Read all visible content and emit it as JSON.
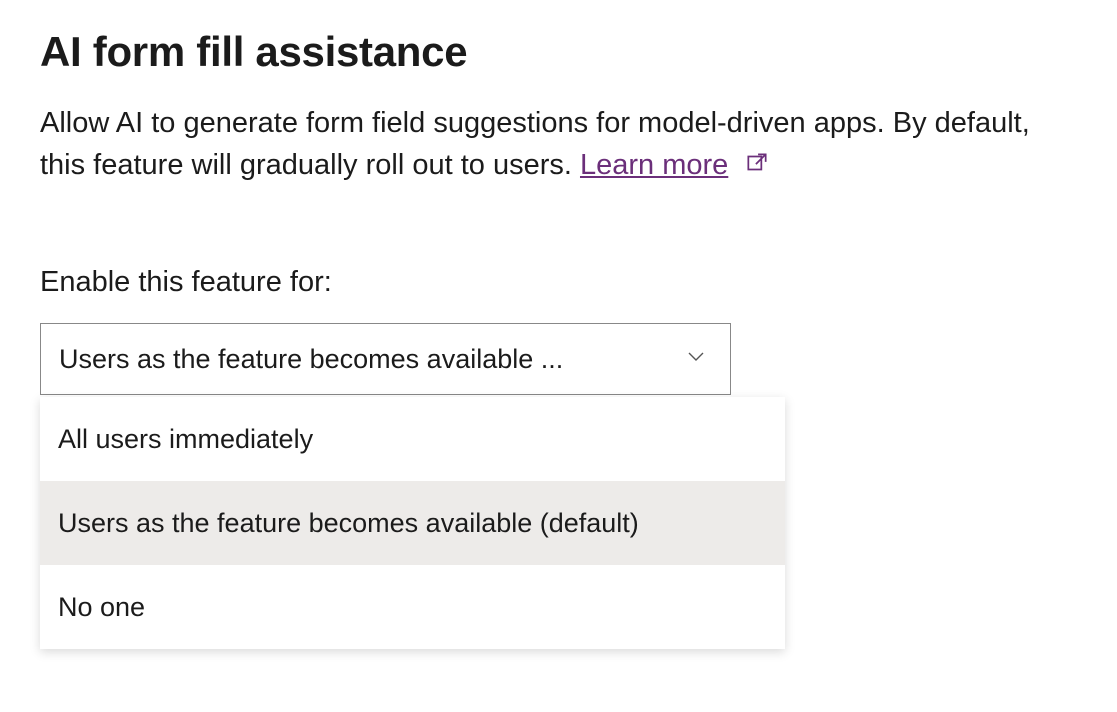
{
  "heading": "AI form fill assistance",
  "description_part1": "Allow AI to generate form field suggestions for model-driven apps. By default, this feature will gradually roll out to users. ",
  "learn_more": "Learn more",
  "field_label": "Enable this feature for:",
  "select": {
    "display": "Users as the feature becomes available ...",
    "options": [
      {
        "label": "All users immediately",
        "selected": false
      },
      {
        "label": "Users as the feature becomes available (default)",
        "selected": true
      },
      {
        "label": "No one",
        "selected": false
      }
    ]
  }
}
